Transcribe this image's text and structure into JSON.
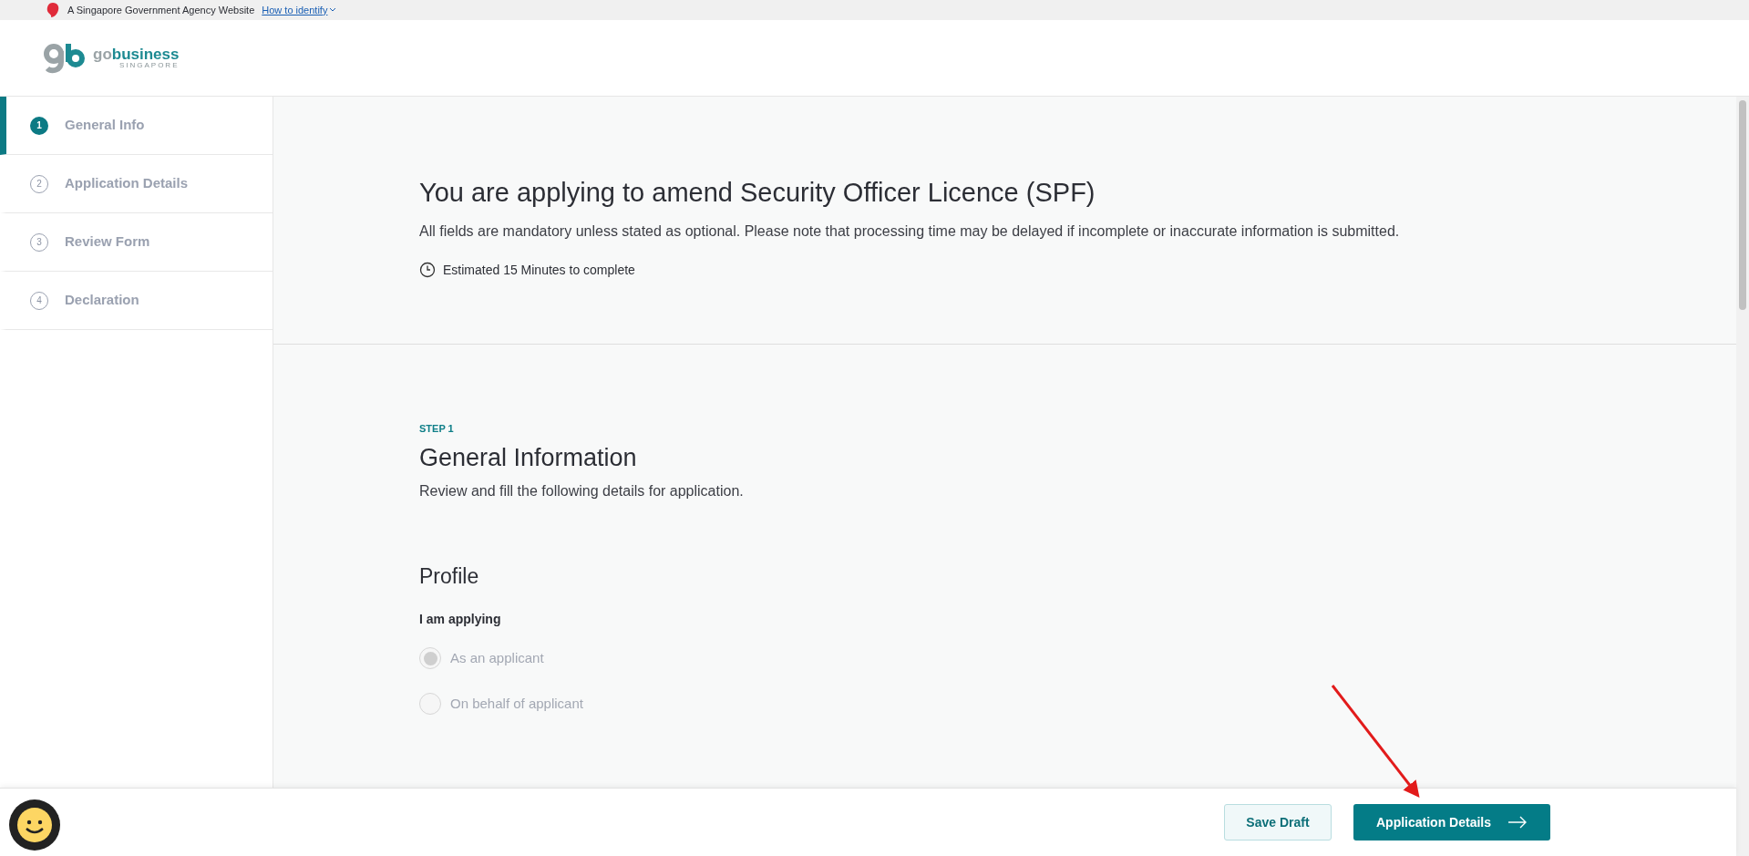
{
  "gov_banner": {
    "text": "A Singapore Government Agency Website",
    "link": "How to identify"
  },
  "logo": {
    "go": "go",
    "business": "business",
    "country": "SINGAPORE"
  },
  "steps": [
    {
      "number": "1",
      "label": "General Info",
      "selected": true
    },
    {
      "number": "2",
      "label": "Application Details",
      "selected": false
    },
    {
      "number": "3",
      "label": "Review Form",
      "selected": false
    },
    {
      "number": "4",
      "label": "Declaration",
      "selected": false
    }
  ],
  "intro": {
    "title": "You are applying to amend Security Officer Licence (SPF)",
    "description": "All fields are mandatory unless stated as optional. Please note that processing time may be delayed if incomplete or inaccurate information is submitted.",
    "estimate": "Estimated 15 Minutes to complete"
  },
  "section": {
    "step_label": "STEP 1",
    "heading": "General Information",
    "subheading": "Review and fill the following details for application.",
    "profile_heading": "Profile",
    "question": "I am applying",
    "options": [
      {
        "label": "As an applicant",
        "selected": true,
        "disabled": true
      },
      {
        "label": "On behalf of applicant",
        "selected": false,
        "disabled": true
      }
    ]
  },
  "footer": {
    "buttons": [
      {
        "kind": "secondary",
        "label": "Save Draft"
      },
      {
        "kind": "primary",
        "label": "Application Details"
      }
    ]
  }
}
